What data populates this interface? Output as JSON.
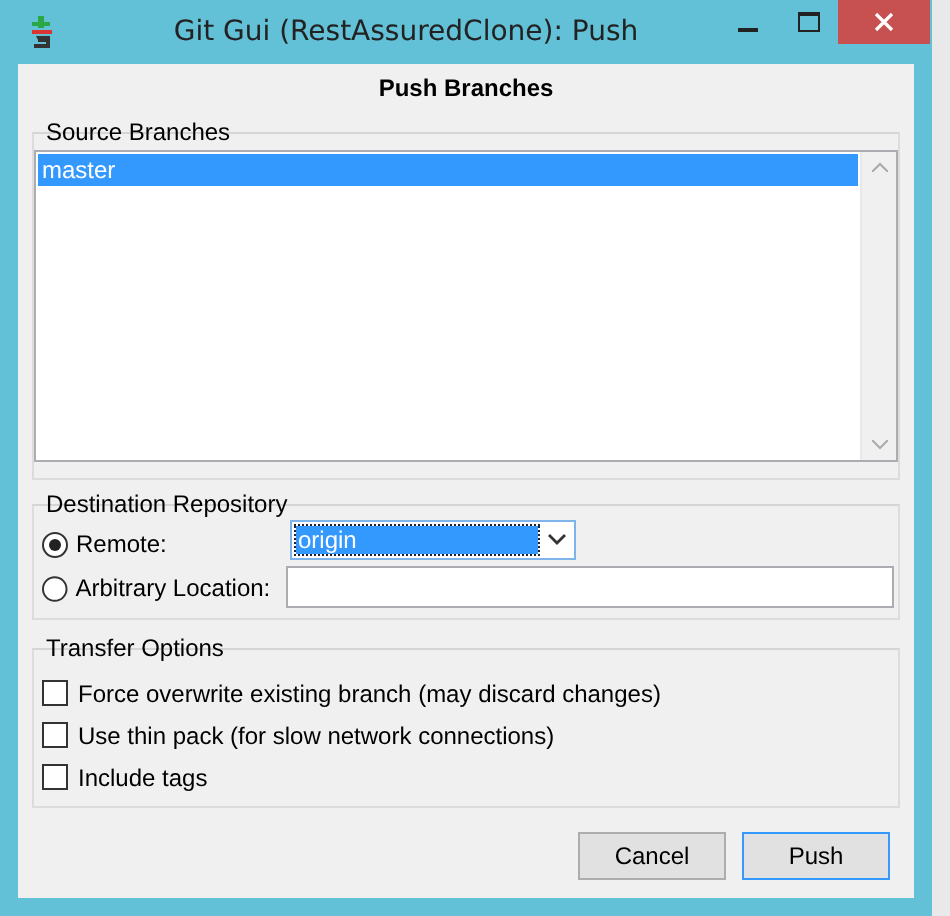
{
  "window": {
    "title": "Git Gui (RestAssuredClone): Push"
  },
  "heading": "Push Branches",
  "source_branches": {
    "label": "Source Branches",
    "items": [
      {
        "name": "master",
        "selected": true
      }
    ]
  },
  "destination": {
    "label": "Destination Repository",
    "options": [
      {
        "label": "Remote:",
        "selected": true,
        "kind": "dropdown",
        "value": "origin"
      },
      {
        "label": "Arbitrary Location:",
        "selected": false,
        "kind": "text"
      }
    ]
  },
  "transfer_options": {
    "label": "Transfer Options",
    "items": [
      {
        "label": "Force overwrite existing branch (may discard changes)",
        "checked": false
      },
      {
        "label": "Use thin pack (for slow network connections)",
        "checked": false
      },
      {
        "label": "Include tags",
        "checked": false
      }
    ]
  },
  "buttons": [
    {
      "label": "Cancel",
      "default": false
    },
    {
      "label": "Push",
      "default": true
    }
  ]
}
